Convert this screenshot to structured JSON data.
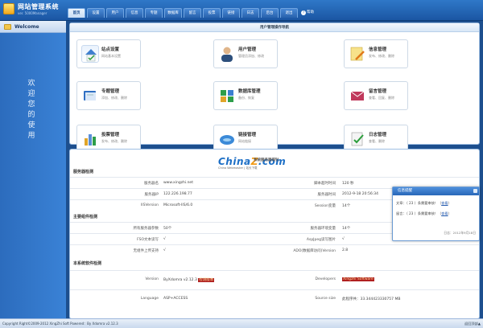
{
  "header": {
    "brand": "网站管理系统",
    "brand_sub": "ver. 5000Manager",
    "tabs": [
      "首页",
      "设置",
      "用户",
      "信息",
      "专题",
      "数据库",
      "留言",
      "投票",
      "链接",
      "日志",
      "后台",
      "退出"
    ],
    "help": "帮助"
  },
  "sidebar": {
    "welcome": "Welcome",
    "vertical_text": "欢迎您的使用"
  },
  "nav_panel": {
    "title": "用户管理操作导航",
    "items": [
      {
        "title": "站点设置",
        "desc": "网站基本设置",
        "icon": "house-check-icon",
        "color": "#3f7fd0"
      },
      {
        "title": "用户管理",
        "desc": "管理员添加、修改",
        "icon": "user-icon",
        "color": "#c9864a"
      },
      {
        "title": "信息管理",
        "desc": "发布、修改、删除",
        "icon": "note-pencil-icon",
        "color": "#e8c23c"
      },
      {
        "title": "专题管理",
        "desc": "添加、修改、删除",
        "icon": "book-icon",
        "color": "#2f6fc3"
      },
      {
        "title": "数据库管理",
        "desc": "备份、恢复",
        "icon": "database-icon",
        "color": "#2e9e4a"
      },
      {
        "title": "留言管理",
        "desc": "查看、回复、删除",
        "icon": "mail-icon",
        "color": "#c0385b"
      },
      {
        "title": "投票管理",
        "desc": "发布、修改、删除",
        "icon": "chart-icon",
        "color": "#5a8fd6"
      },
      {
        "title": "链接管理",
        "desc": "网站链接",
        "icon": "globe-icon",
        "color": "#3b8ad8"
      },
      {
        "title": "日志管理",
        "desc": "查看、删除",
        "icon": "checklist-icon",
        "color": "#5a9e3a"
      }
    ]
  },
  "probe": {
    "logo_main": "China",
    "logo_z": "Z",
    "logo_tail": ".com",
    "logo_sub": "China Webmaster | 站长下载",
    "title": "系统服务器探针",
    "sections": {
      "server": "服务器检测",
      "components": "主要组件检测",
      "software": "本系统软件检测"
    },
    "server_rows": [
      {
        "l1": "服务器名",
        "v1": "www.xingzhi.net",
        "l2": "脚本超时时间",
        "v2": "120 秒"
      },
      {
        "l1": "服务器IP",
        "v1": "122.226.198.77",
        "l2": "服务器时间",
        "v2": "2012-9-18 20:56:34"
      },
      {
        "l1": "IISVersion",
        "v1": "Microsoft-IIS/6.0",
        "l2": "Session变量",
        "v2": "14个"
      }
    ],
    "component_rows": [
      {
        "l1": "所有服务器参数",
        "v1": "50个",
        "l2": "服务器环境变量",
        "v2": "14个"
      },
      {
        "l1": "FSO文本读写",
        "v1": "√",
        "l2": "AspJpeg读写图片",
        "v2": "√"
      },
      {
        "l1": "无组件上传支持",
        "v1": "√",
        "l2": "ADO(数据库访问)Version",
        "v2": "2.8"
      }
    ],
    "software_rows": [
      {
        "l1": "Version",
        "v1": "ByXdomra v2.12.3",
        "v1b": "检测版本",
        "l2": "Developers",
        "v2": "Xingzhi Software"
      },
      {
        "l1": "Language",
        "v1": "ASP+ACCESS",
        "l2": "Source size",
        "v2": "此程序共：33.344423330757 MB"
      }
    ]
  },
  "popup": {
    "title": "信息提醒",
    "line1": "文章：（ 23 ）条需要审核！（",
    "line1_link": "查看",
    "line2": "留言：（ 23 ）条需要审核！（",
    "line2_link": "查看",
    "close_paren": "）",
    "footer": "日志：2012年9月18日"
  },
  "footer": {
    "copyright": "Copyright Right©2009-2012 XingZhi Soft Powered：By Xdomra v2.12.3",
    "totop": "返回顶部▲"
  }
}
